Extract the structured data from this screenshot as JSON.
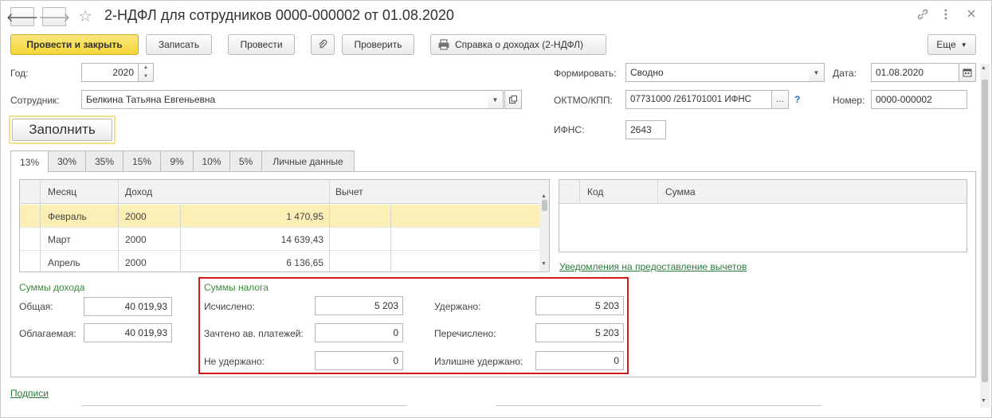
{
  "window": {
    "title": "2-НДФЛ для сотрудников 0000-000002 от 01.08.2020",
    "nav_back": "🡐",
    "nav_forward": "🡒",
    "icons": [
      "link-icon",
      "more-icon",
      "close-icon"
    ]
  },
  "toolbar": {
    "post_close": "Провести и закрыть",
    "save": "Записать",
    "post": "Провести",
    "check": "Проверить",
    "income_cert": "Справка о доходах (2-НДФЛ)",
    "more": "Еще"
  },
  "form": {
    "year_label": "Год:",
    "year_value": "2020",
    "employee_label": "Сотрудник:",
    "employee_value": "Белкина Татьяна Евгеньевна",
    "fill_button": "Заполнить",
    "form_label": "Формировать:",
    "form_value": "Сводно",
    "oktmo_label": "ОКТМО/КПП:",
    "oktmo_value": "07731000   /261701001 ИФНС",
    "help": "?",
    "ifns_label": "ИФНС:",
    "ifns_value": "2643",
    "date_label": "Дата:",
    "date_value": "01.08.2020",
    "number_label": "Номер:",
    "number_value": "0000-000002"
  },
  "tabs": [
    "13%",
    "30%",
    "35%",
    "15%",
    "9%",
    "10%",
    "5%",
    "Личные данные"
  ],
  "income_table": {
    "headers": [
      "Месяц",
      "Доход",
      "Вычет"
    ],
    "rows": [
      {
        "month": "Февраль",
        "code": "2000",
        "amount": "1 470,95"
      },
      {
        "month": "Март",
        "code": "2000",
        "amount": "14 639,43"
      },
      {
        "month": "Апрель",
        "code": "2000",
        "amount": "6 136,65"
      }
    ]
  },
  "deduction_table": {
    "headers": [
      "Код",
      "Сумма"
    ]
  },
  "deductions_link": "Уведомления на предоставление вычетов",
  "income_sums": {
    "title": "Суммы дохода",
    "total_label": "Общая:",
    "total_value": "40 019,93",
    "taxable_label": "Облагаемая:",
    "taxable_value": "40 019,93"
  },
  "tax_sums": {
    "title": "Суммы налога",
    "calculated_label": "Исчислено:",
    "calculated_value": "5 203",
    "advance_label": "Зачтено ав. платежей:",
    "advance_value": "0",
    "not_withheld_label": "Не удержано:",
    "not_withheld_value": "0",
    "withheld_label": "Удержано:",
    "withheld_value": "5 203",
    "transferred_label": "Перечислено:",
    "transferred_value": "5 203",
    "over_withheld_label": "Излишне удержано:",
    "over_withheld_value": "0"
  },
  "signatures_link": "Подписи",
  "colors": {
    "primary_button": "#f5d636",
    "highlight_box": "#d21a1a",
    "selected_row": "#fcefb5",
    "section_title": "#3a8a3a"
  }
}
